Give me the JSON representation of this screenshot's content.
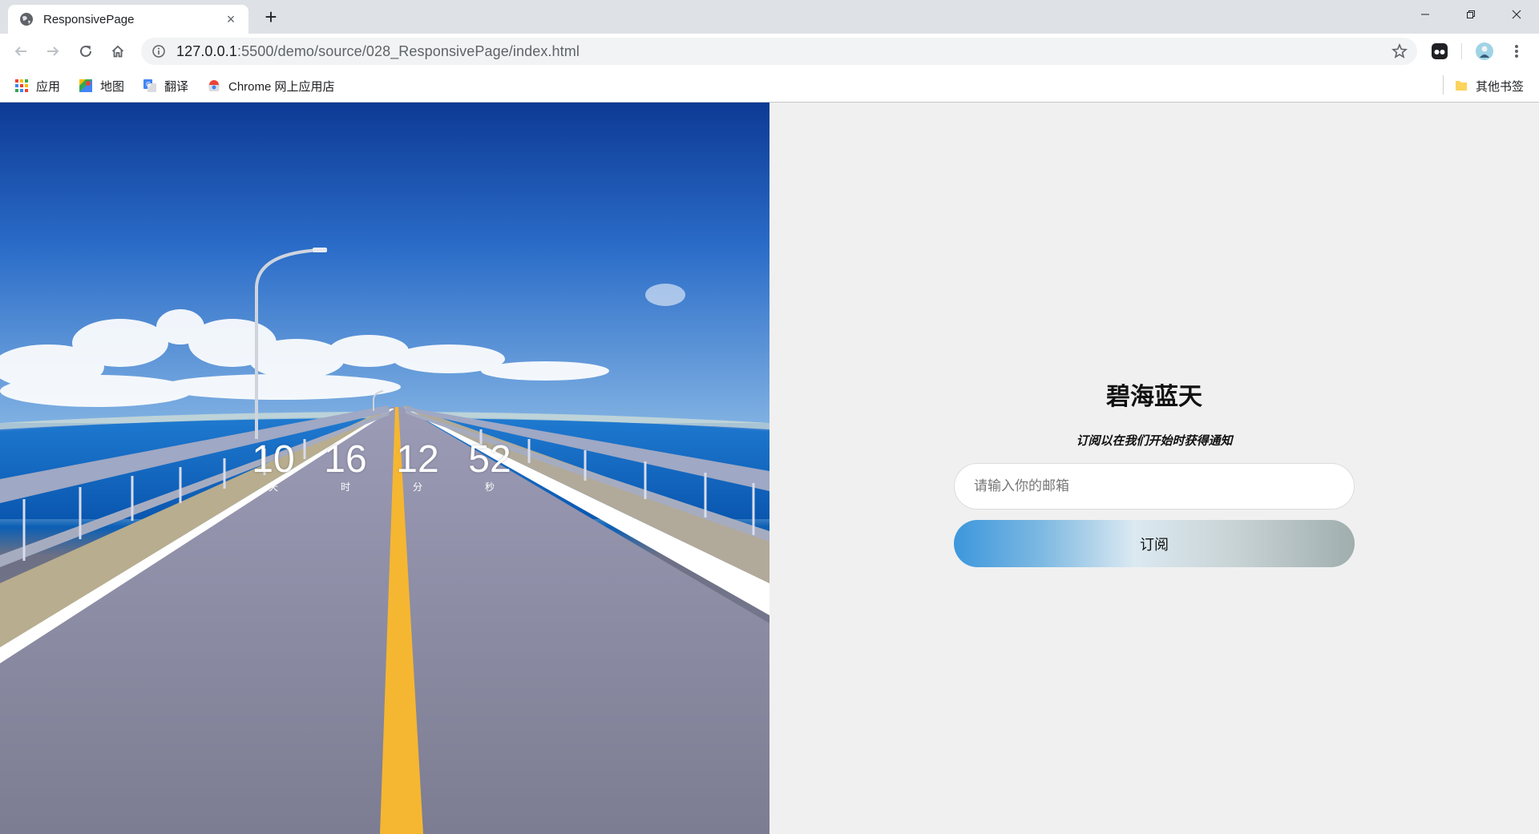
{
  "browser": {
    "tab_title": "ResponsivePage",
    "tab_close": "×",
    "new_tab": "+",
    "url_host": "127.0.0.1",
    "url_rest": ":5500/demo/source/028_ResponsivePage/index.html",
    "bookmarks": {
      "apps": "应用",
      "maps": "地图",
      "translate": "翻译",
      "webstore": "Chrome 网上应用店",
      "other": "其他书签"
    }
  },
  "countdown": {
    "days": "10",
    "days_label": "天",
    "hours": "16",
    "hours_label": "时",
    "minutes": "12",
    "minutes_label": "分",
    "seconds": "52",
    "seconds_label": "秒"
  },
  "subscribe": {
    "title": "碧海蓝天",
    "subtitle": "订阅以在我们开始时获得通知",
    "email_placeholder": "请输入你的邮箱",
    "button_label": "订阅"
  },
  "colors": {
    "panel_bg": "#f0f0f0",
    "button_gradient_start": "#3c97dc",
    "button_gradient_end": "#a0aeae",
    "road_stripe": "#f5b731"
  }
}
